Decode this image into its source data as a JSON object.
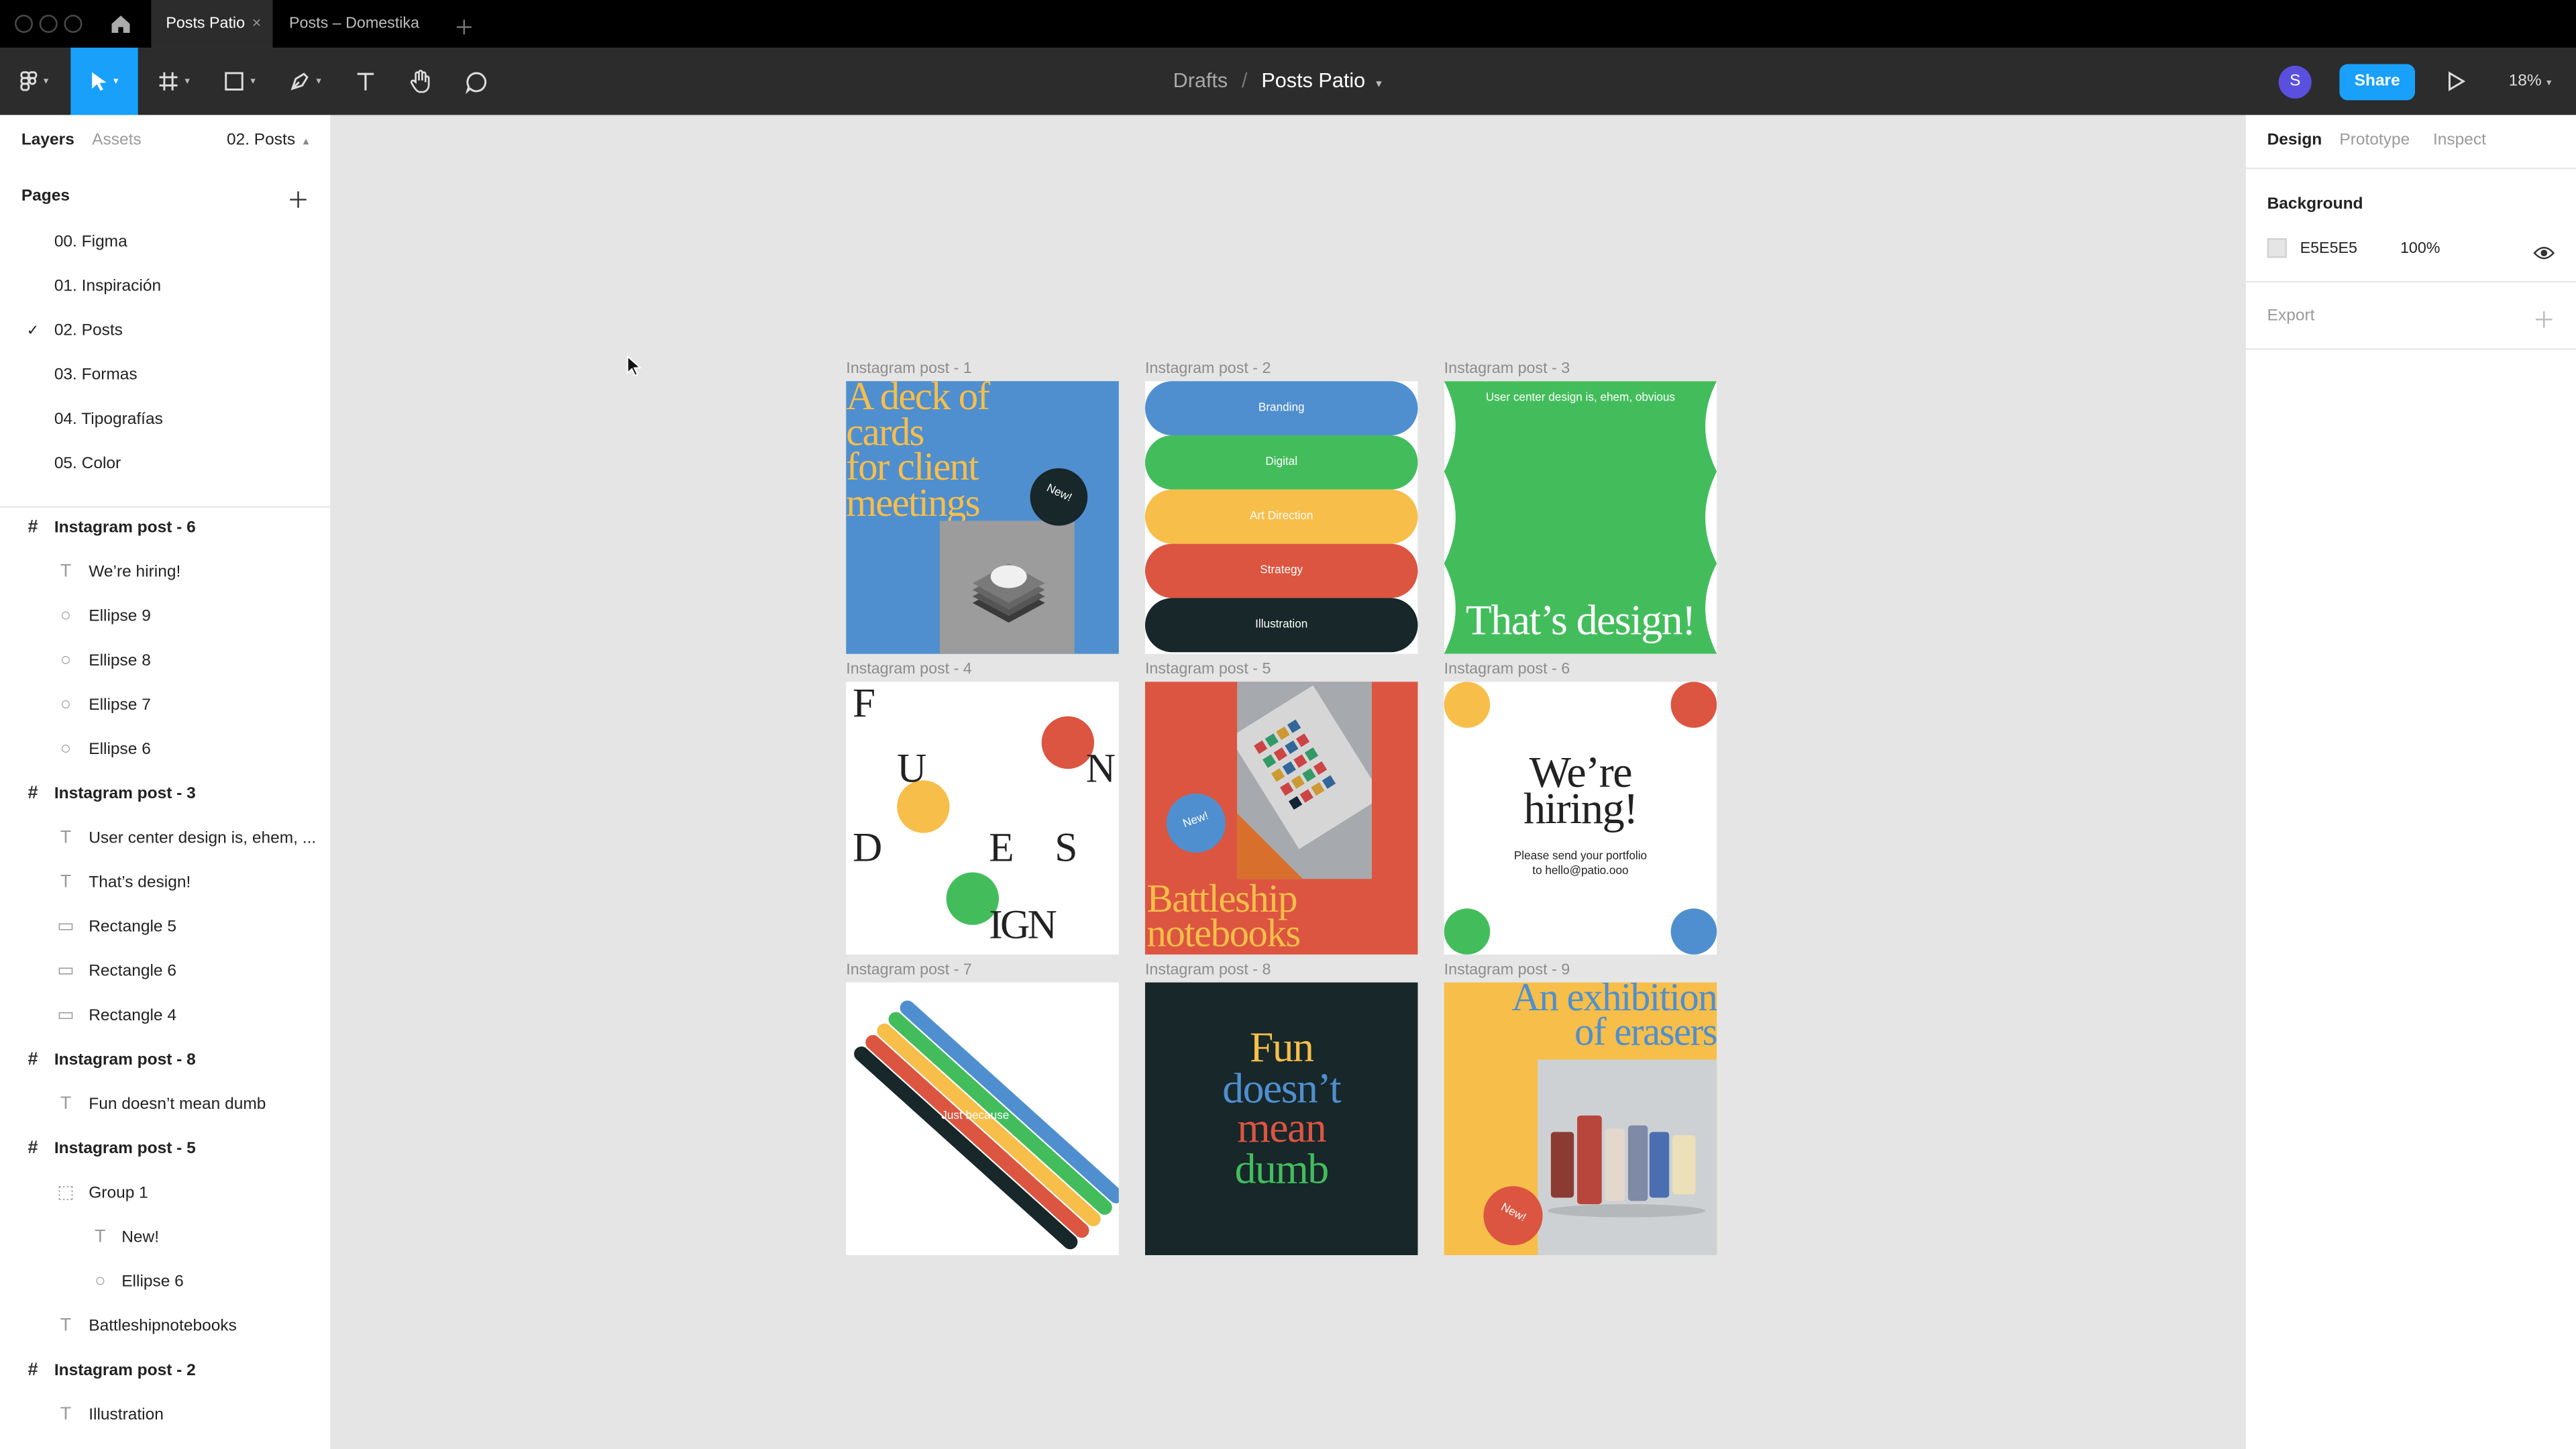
{
  "tabs": [
    {
      "label": "Posts Patio",
      "close": "×"
    },
    {
      "label": "Posts – Domestika"
    }
  ],
  "toolbar": {
    "breadcrumb_parent": "Drafts",
    "breadcrumb_sep": "/",
    "file_name": "Posts Patio",
    "avatar_letter": "S",
    "share": "Share",
    "zoom": "18%"
  },
  "left": {
    "tab_layers": "Layers",
    "tab_assets": "Assets",
    "page_selector": "02. Posts",
    "pages_title": "Pages",
    "pages": [
      "00. Figma",
      "01. Inspiración",
      "02. Posts",
      "03. Formas",
      "04. Tipografías",
      "05. Color"
    ],
    "layers": [
      {
        "label": "Instagram post - 6",
        "kind": "frame",
        "indent": 0
      },
      {
        "label": "We’re hiring!",
        "kind": "text",
        "indent": 1
      },
      {
        "label": "Ellipse 9",
        "kind": "ellipse",
        "indent": 1
      },
      {
        "label": "Ellipse 8",
        "kind": "ellipse",
        "indent": 1
      },
      {
        "label": "Ellipse 7",
        "kind": "ellipse",
        "indent": 1
      },
      {
        "label": "Ellipse 6",
        "kind": "ellipse",
        "indent": 1
      },
      {
        "label": "Instagram post - 3",
        "kind": "frame",
        "indent": 0
      },
      {
        "label": "User center design is, ehem, ...",
        "kind": "text",
        "indent": 1
      },
      {
        "label": "That’s design!",
        "kind": "text",
        "indent": 1
      },
      {
        "label": "Rectangle 5",
        "kind": "rect",
        "indent": 1
      },
      {
        "label": "Rectangle 6",
        "kind": "rect",
        "indent": 1
      },
      {
        "label": "Rectangle 4",
        "kind": "rect",
        "indent": 1
      },
      {
        "label": "Instagram post - 8",
        "kind": "frame",
        "indent": 0
      },
      {
        "label": "Fun doesn’t mean dumb",
        "kind": "text",
        "indent": 1
      },
      {
        "label": "Instagram post - 5",
        "kind": "frame",
        "indent": 0
      },
      {
        "label": "Group 1",
        "kind": "group",
        "indent": 1
      },
      {
        "label": "New!",
        "kind": "text",
        "indent": 2
      },
      {
        "label": "Ellipse 6",
        "kind": "ellipse",
        "indent": 2
      },
      {
        "label": "Battleshipnotebooks",
        "kind": "text",
        "indent": 1
      },
      {
        "label": "Instagram post - 2",
        "kind": "frame",
        "indent": 0
      },
      {
        "label": "Illustration",
        "kind": "text",
        "indent": 1
      }
    ]
  },
  "right": {
    "tab_design": "Design",
    "tab_prototype": "Prototype",
    "tab_inspect": "Inspect",
    "background_title": "Background",
    "bg_hex": "E5E5E5",
    "bg_opacity": "100%",
    "export_title": "Export",
    "bg_color": "#E5E5E5"
  },
  "frames": [
    "Instagram post - 1",
    "Instagram post - 2",
    "Instagram post - 3",
    "Instagram post - 4",
    "Instagram post - 5",
    "Instagram post - 6",
    "Instagram post - 7",
    "Instagram post - 8",
    "Instagram post - 9"
  ],
  "posts": {
    "p1": {
      "headline": [
        "A deck of",
        "cards",
        "for client",
        "meetings"
      ],
      "badge": "New!"
    },
    "p2": {
      "pills": [
        "Branding",
        "Digital",
        "Art Direction",
        "Strategy",
        "Illustration"
      ]
    },
    "p3": {
      "top": "User center design is, ehem, obvious",
      "headline": "That’s design!"
    },
    "p4": {
      "letters": [
        "F",
        "U",
        "N",
        "D",
        "E",
        "S",
        "IGN"
      ]
    },
    "p5": {
      "badge": "New!",
      "headline": [
        "Battleship",
        "notebooks"
      ]
    },
    "p6": {
      "headline": [
        "We’re",
        "hiring!"
      ],
      "sub": [
        "Please send your portfolio",
        "to hello@patio.ooo"
      ]
    },
    "p7": {
      "label": "Just because"
    },
    "p8": {
      "lines": [
        "Fun",
        "doesn’t",
        "mean",
        "dumb"
      ]
    },
    "p9": {
      "headline": [
        "An exhibition",
        "of erasers"
      ],
      "badge": "New!"
    }
  },
  "help": "?",
  "colors": {
    "blue": "#4f8fcf",
    "green": "#43bd5c",
    "yellow": "#f7be4a",
    "red": "#dc5540",
    "dark": "#17272a",
    "accent": "#18a0fb",
    "avatar": "#5b4fe0"
  }
}
